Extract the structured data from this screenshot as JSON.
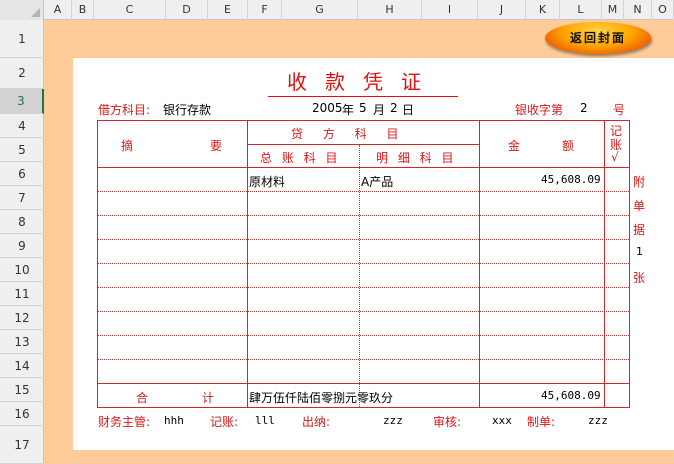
{
  "columns": [
    "A",
    "B",
    "C",
    "D",
    "E",
    "F",
    "G",
    "H",
    "I",
    "J",
    "K",
    "L",
    "M",
    "N",
    "O"
  ],
  "rows": [
    "1",
    "2",
    "3",
    "4",
    "5",
    "6",
    "7",
    "8",
    "9",
    "10",
    "11",
    "12",
    "13",
    "14",
    "15",
    "16",
    "17"
  ],
  "active_row": "3",
  "button": {
    "label": "返回封面"
  },
  "voucher": {
    "title": "收款凭证",
    "debit_account_label": "借方科目:",
    "debit_account_value": "银行存款",
    "date_year": "2005",
    "date_year_unit": "年",
    "date_month": "5",
    "date_month_unit": "月",
    "date_day": "2",
    "date_day_unit": "日",
    "number_label": "银收字第",
    "number_value": "2",
    "number_unit": "号",
    "headers": {
      "summary_left": "摘",
      "summary_right": "要",
      "credit_account": "贷 方 科 目",
      "general_ledger": "总 账 科 目",
      "detail_account": "明 细 科 目",
      "amount_left": "金",
      "amount_right": "额",
      "posted_1": "记",
      "posted_2": "账",
      "posted_3": "√"
    },
    "entries": [
      {
        "general": "原材料",
        "detail": "A产品",
        "amount": "45,608.09"
      }
    ],
    "total": {
      "label_left": "合",
      "label_right": "计",
      "amount_words": "肆万伍仟陆佰零捌元零玖分",
      "amount": "45,608.09"
    },
    "attachments": {
      "c1": "附",
      "c2": "单",
      "c3": "据",
      "count": "1",
      "c4": "张"
    },
    "signatures": {
      "finance_label": "财务主管:",
      "finance_value": "hhh",
      "bookkeeper_label": "记账:",
      "bookkeeper_value": "lll",
      "cashier_label": "出纳:",
      "cashier_value": "zzz",
      "review_label": "审核:",
      "review_value": "xxx",
      "maker_label": "制单:",
      "maker_value": "zzz"
    }
  }
}
